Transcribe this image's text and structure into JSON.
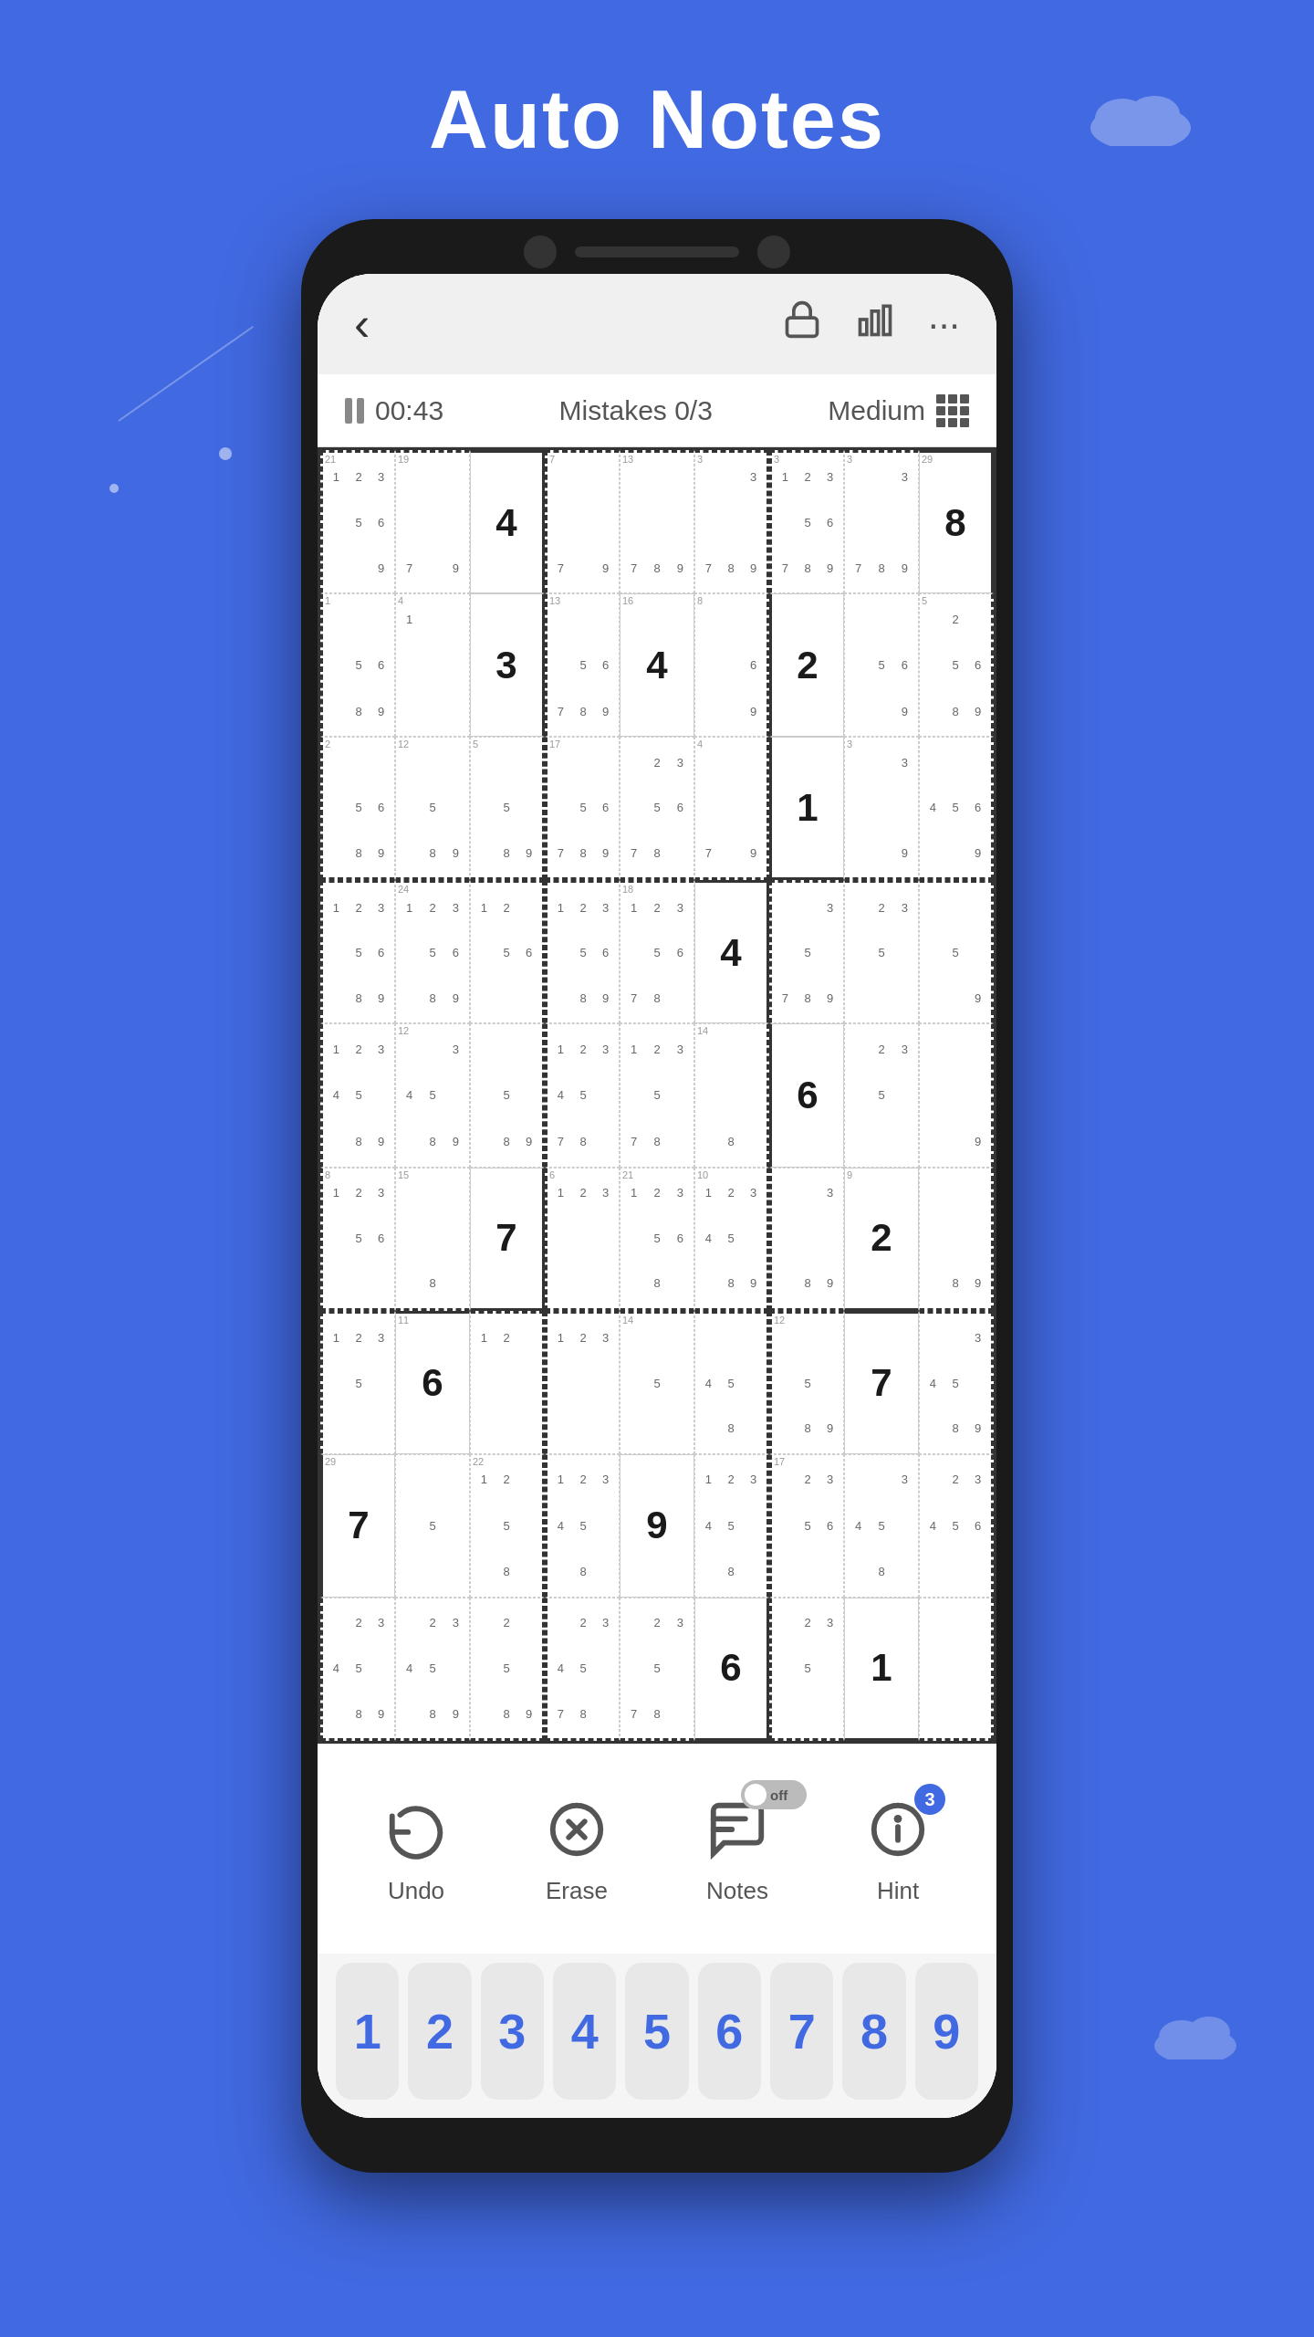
{
  "page": {
    "title": "Auto Notes",
    "background_color": "#4169e1"
  },
  "header": {
    "back_label": "‹",
    "icons": [
      "lock-icon",
      "chart-icon",
      "more-icon"
    ]
  },
  "status": {
    "timer": "00:43",
    "mistakes": "Mistakes 0/3",
    "difficulty": "Medium"
  },
  "toolbar": {
    "undo_label": "Undo",
    "erase_label": "Erase",
    "notes_label": "Notes",
    "hint_label": "Hint",
    "notes_toggle_state": "off",
    "hint_count": "3"
  },
  "number_pad": [
    "1",
    "2",
    "3",
    "4",
    "5",
    "6",
    "7",
    "8",
    "9"
  ],
  "grid": {
    "cells": [
      {
        "id": 1,
        "value": "",
        "notes": "123\n56\n9",
        "badge": "21"
      },
      {
        "id": 2,
        "value": "",
        "notes": "7 9",
        "badge": "19"
      },
      {
        "id": 3,
        "value": "4",
        "notes": "",
        "badge": ""
      },
      {
        "id": 4,
        "value": "",
        "notes": "7 9",
        "badge": "7"
      },
      {
        "id": 5,
        "value": "",
        "notes": "7 8 9",
        "badge": "13"
      },
      {
        "id": 6,
        "value": "",
        "notes": "3\n789",
        "badge": "3"
      },
      {
        "id": 7,
        "value": "",
        "notes": "123\n56\n789",
        "badge": "3"
      },
      {
        "id": 8,
        "value": "",
        "notes": "3\n789",
        "badge": "3"
      },
      {
        "id": 9,
        "value": "8",
        "notes": "",
        "badge": "29"
      },
      {
        "id": 10,
        "value": "",
        "notes": "56\n89",
        "badge": "1"
      },
      {
        "id": 11,
        "value": "",
        "notes": "1",
        "badge": "4"
      },
      {
        "id": 12,
        "value": "3",
        "notes": "",
        "badge": ""
      },
      {
        "id": 13,
        "value": "",
        "notes": "56\n789",
        "badge": "13"
      },
      {
        "id": 14,
        "value": "4",
        "notes": "",
        "badge": "16"
      },
      {
        "id": 15,
        "value": "",
        "notes": "6\n9",
        "badge": "8"
      },
      {
        "id": 16,
        "value": "2",
        "notes": "",
        "badge": ""
      },
      {
        "id": 17,
        "value": "",
        "notes": "56\n9",
        "badge": ""
      },
      {
        "id": 18,
        "value": "",
        "notes": "256\n89",
        "badge": "5"
      },
      {
        "id": 19,
        "value": "",
        "notes": "56\n89",
        "badge": "2"
      },
      {
        "id": 20,
        "value": "",
        "notes": "5\n89",
        "badge": "12"
      },
      {
        "id": 21,
        "value": "",
        "notes": "5\n89",
        "badge": "5"
      },
      {
        "id": 22,
        "value": "",
        "notes": "56\n789",
        "badge": "17"
      },
      {
        "id": 23,
        "value": "",
        "notes": "23\n56\n78",
        "badge": ""
      },
      {
        "id": 24,
        "value": "",
        "notes": "7 9",
        "badge": "4"
      },
      {
        "id": 25,
        "value": "1",
        "notes": "",
        "badge": ""
      },
      {
        "id": 26,
        "value": "",
        "notes": "3\n9",
        "badge": "3"
      },
      {
        "id": 27,
        "value": "",
        "notes": "456\n9",
        "badge": ""
      },
      {
        "id": 28,
        "value": "",
        "notes": "123\n56\n89",
        "badge": ""
      },
      {
        "id": 29,
        "value": "",
        "notes": "123\n56\n89",
        "badge": "24"
      },
      {
        "id": 30,
        "value": "",
        "notes": "12\n56",
        "badge": ""
      },
      {
        "id": 31,
        "value": "",
        "notes": "123\n56\n89",
        "badge": ""
      },
      {
        "id": 32,
        "value": "",
        "notes": "123\n56\n78",
        "badge": "18"
      },
      {
        "id": 33,
        "value": "4",
        "notes": "",
        "badge": ""
      },
      {
        "id": 34,
        "value": "",
        "notes": "3\n5\n789",
        "badge": ""
      },
      {
        "id": 35,
        "value": "",
        "notes": "23\n5",
        "badge": ""
      },
      {
        "id": 36,
        "value": "",
        "notes": "5\n9",
        "badge": ""
      },
      {
        "id": 37,
        "value": "",
        "notes": "123\n45\n89",
        "badge": ""
      },
      {
        "id": 38,
        "value": "",
        "notes": "3\n45\n89",
        "badge": "12"
      },
      {
        "id": 39,
        "value": "",
        "notes": "5\n89",
        "badge": ""
      },
      {
        "id": 40,
        "value": "",
        "notes": "123\n45\n78",
        "badge": ""
      },
      {
        "id": 41,
        "value": "",
        "notes": "123\n5\n78",
        "badge": ""
      },
      {
        "id": 42,
        "value": "",
        "notes": "8",
        "badge": "14"
      },
      {
        "id": 43,
        "value": "6",
        "notes": "",
        "badge": ""
      },
      {
        "id": 44,
        "value": "",
        "notes": "23\n5",
        "badge": ""
      },
      {
        "id": 45,
        "value": "",
        "notes": "9",
        "badge": ""
      },
      {
        "id": 46,
        "value": "",
        "notes": "123\n56",
        "badge": "8"
      },
      {
        "id": 47,
        "value": "",
        "notes": "8",
        "badge": "15"
      },
      {
        "id": 48,
        "value": "7",
        "notes": "",
        "badge": ""
      },
      {
        "id": 49,
        "value": "",
        "notes": "123",
        "badge": "6"
      },
      {
        "id": 50,
        "value": "",
        "notes": "123\n56\n8",
        "badge": "21"
      },
      {
        "id": 51,
        "value": "",
        "notes": "123\n45\n89",
        "badge": "10"
      },
      {
        "id": 52,
        "value": "",
        "notes": "3\n89",
        "badge": ""
      },
      {
        "id": 53,
        "value": "2",
        "notes": "",
        "badge": "9"
      },
      {
        "id": 54,
        "value": "",
        "notes": "89",
        "badge": ""
      },
      {
        "id": 55,
        "value": "",
        "notes": "123\n5",
        "badge": ""
      },
      {
        "id": 56,
        "value": "6",
        "notes": "",
        "badge": "11"
      },
      {
        "id": 57,
        "value": "",
        "notes": "12",
        "badge": ""
      },
      {
        "id": 58,
        "value": "",
        "notes": "123",
        "badge": ""
      },
      {
        "id": 59,
        "value": "",
        "notes": "5",
        "badge": "14"
      },
      {
        "id": 60,
        "value": "",
        "notes": "45\n8",
        "badge": ""
      },
      {
        "id": 61,
        "value": "",
        "notes": "5\n89",
        "badge": "12"
      },
      {
        "id": 62,
        "value": "7",
        "notes": "",
        "badge": ""
      },
      {
        "id": 63,
        "value": "",
        "notes": "3\n45\n89",
        "badge": ""
      },
      {
        "id": 64,
        "value": "7",
        "notes": "",
        "badge": "29"
      },
      {
        "id": 65,
        "value": "",
        "notes": "5",
        "badge": ""
      },
      {
        "id": 66,
        "value": "",
        "notes": "12\n5\n8",
        "badge": "22"
      },
      {
        "id": 67,
        "value": "",
        "notes": "123\n45\n8",
        "badge": ""
      },
      {
        "id": 68,
        "value": "9",
        "notes": "",
        "badge": ""
      },
      {
        "id": 69,
        "value": "",
        "notes": "123\n45\n8",
        "badge": ""
      },
      {
        "id": 70,
        "value": "",
        "notes": "23\n56",
        "badge": "17"
      },
      {
        "id": 71,
        "value": "",
        "notes": "3\n45\n8",
        "badge": ""
      },
      {
        "id": 72,
        "value": "",
        "notes": "23\n456",
        "badge": ""
      },
      {
        "id": 73,
        "value": "",
        "notes": "23\n45\n89",
        "badge": ""
      },
      {
        "id": 74,
        "value": "",
        "notes": "23\n45\n89",
        "badge": ""
      },
      {
        "id": 75,
        "value": "",
        "notes": "2\n5\n89",
        "badge": ""
      },
      {
        "id": 76,
        "value": "",
        "notes": "23\n45\n78",
        "badge": ""
      },
      {
        "id": 77,
        "value": "",
        "notes": "23\n5\n78",
        "badge": ""
      },
      {
        "id": 78,
        "value": "6",
        "notes": "",
        "badge": ""
      },
      {
        "id": 79,
        "value": "",
        "notes": "23\n5",
        "badge": ""
      },
      {
        "id": 80,
        "value": "1",
        "notes": "",
        "badge": ""
      },
      {
        "id": 81,
        "value": "",
        "notes": "",
        "badge": ""
      }
    ]
  }
}
